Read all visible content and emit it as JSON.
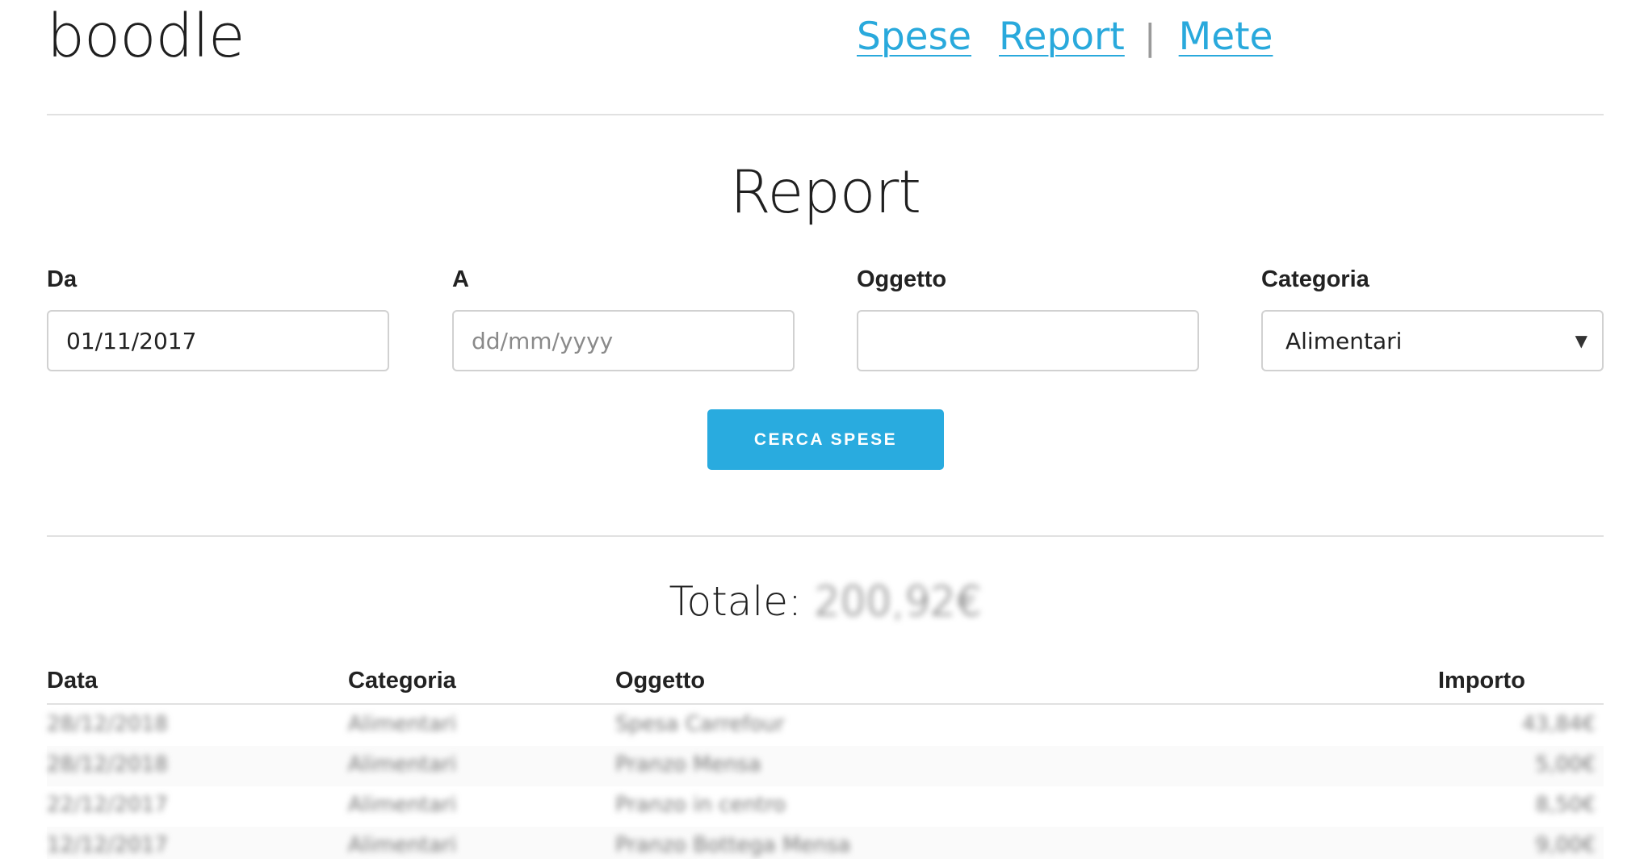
{
  "header": {
    "logo": "boodle",
    "nav": {
      "spese": "Spese",
      "report": "Report",
      "separator": "|",
      "mete": "Mete"
    }
  },
  "main": {
    "title": "Report",
    "form": {
      "da_label": "Da",
      "da_value": "01/11/2017",
      "a_label": "A",
      "a_placeholder": "dd/mm/yyyy",
      "oggetto_label": "Oggetto",
      "oggetto_value": "",
      "categoria_label": "Categoria",
      "categoria_selected": "Alimentari",
      "submit_label": "CERCA SPESE"
    },
    "totale_label": "Totale:",
    "totale_value": "200,92€",
    "table": {
      "headers": [
        "Data",
        "Categoria",
        "Oggetto",
        "Importo"
      ],
      "rows": [
        [
          "28/12/2018",
          "Alimentari",
          "Spesa Carrefour",
          "43,84€"
        ],
        [
          "28/12/2018",
          "Alimentari",
          "Pranzo Mensa",
          "5,00€"
        ],
        [
          "22/12/2017",
          "Alimentari",
          "Pranzo in centro",
          "8,50€"
        ],
        [
          "12/12/2017",
          "Alimentari",
          "Pranzo Bottega Mensa",
          "9,00€"
        ]
      ]
    }
  },
  "colors": {
    "accent": "#29abdf",
    "link": "#29a9dc",
    "divider": "#e1e1e1",
    "border": "#d1d1d1"
  },
  "icons": {
    "select_caret": "caret-down-icon"
  }
}
